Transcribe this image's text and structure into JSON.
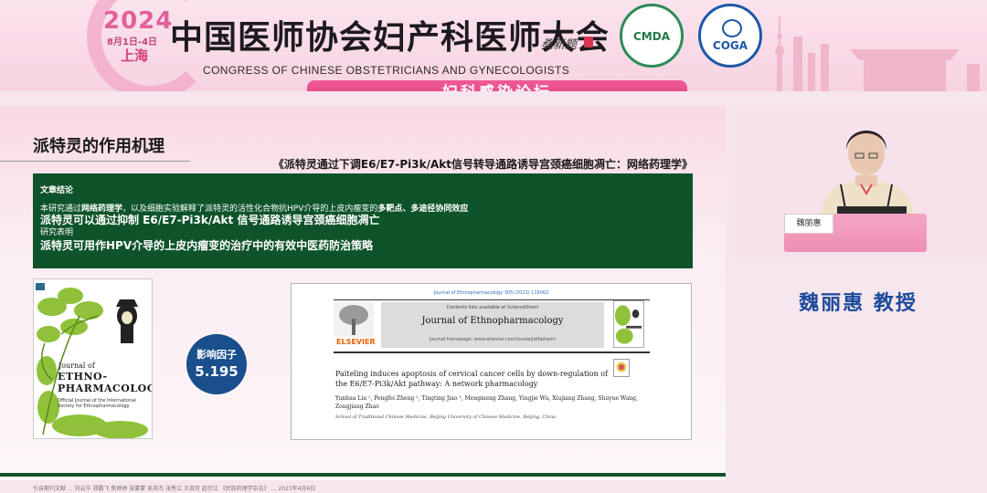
{
  "banner": {
    "year": "2024",
    "dates": "8月1日-4日",
    "city": "上海",
    "cn_title": "中国医师协会妇产科医师大会",
    "signature": "桑新题",
    "en_title": "CONGRESS OF CHINESE OBSTETRICIANS AND GYNECOLOGISTS",
    "logo_cmda": "CMDA",
    "logo_coga": "COGA",
    "forum": "妇科感染论坛"
  },
  "slide": {
    "title": "派特灵的作用机理",
    "paper_cn": "《派特灵通过下调E6/E7-Pi3k/Akt信号转导通路诱导宫颈癌细胞凋亡：网络药理学》",
    "conclusion": {
      "heading": "文章结论",
      "p1_pre": "本研究通过",
      "p1_bold1": "网络药理学",
      "p1_mid": "，以及细胞实验解释了派特灵的活性化合物抗HPV介导的上皮内瘤变的",
      "p1_bold2": "多靶点、多途径协同效应",
      "line2": "派特灵可以通过抑制 E6/E7-Pi3k/Akt 信号通路诱导宫颈癌细胞凋亡",
      "line3": "研究表明",
      "line4": "派特灵可用作HPV介导的上皮内瘤变的治疗中的有效中医药防治策略"
    },
    "cover": {
      "line1": "Journal of",
      "line2": "ETHNO-",
      "line3": "PHARMACOLOGY",
      "line4": "Official Journal of the International Society for Ethnopharmacology"
    },
    "impact": {
      "label": "影响因子",
      "value": "5.195"
    },
    "article": {
      "citation": "Journal of Ethnopharmacology 305 (2023) 116062",
      "contents": "Contents lists available at ScienceDirect",
      "journal": "Journal of Ethnopharmacology",
      "homepage": "journal homepage: www.elsevier.com/locate/jethpharm",
      "publisher": "ELSEVIER",
      "title": "Paiteling induces apoptosis of cervical cancer cells by down-regulation of the E6/E7-Pi3k/Akt pathway: A network pharmacology",
      "authors": "Yunhua Liu ¹, Pengfei Zheng ¹, Tingting Jiao ¹, Mengmeng Zhang, Yingjie Wu, Xiujiang Zhang, Shuyue Wang, Zongjiang Zhao",
      "affiliation": "School of Traditional Chinese Medicine, Beijing University of Chinese Medicine, Beijing, China"
    },
    "footnote": "引自期刊文献 ... 刘云华 郑鹏飞 焦婷婷 张蒙蒙 吴英杰 张秀江 王淑月 赵宗江 《民族药理学杂志》 ... 2023年4月6日"
  },
  "speaker": {
    "nameplate": "魏丽惠",
    "name": "魏丽惠 教授"
  },
  "colors": {
    "banner_pink": "#f7d3e2",
    "forum_pink": "#e24585",
    "conclusion_green": "#0e5329",
    "impact_blue": "#184f8c",
    "speaker_name_blue": "#1d4b9b"
  }
}
